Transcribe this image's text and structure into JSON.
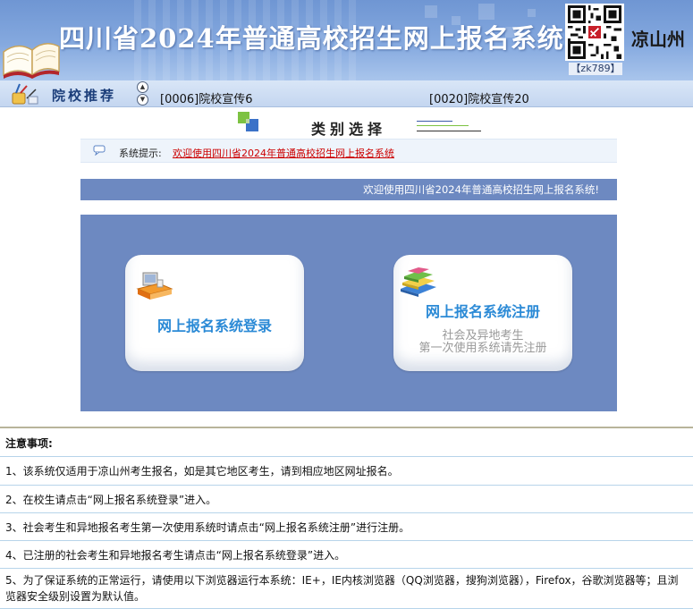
{
  "header": {
    "title": "四川省2024年普通高校招生网上报名系统",
    "region": "凉山州",
    "qr_code_label": "【zk789】"
  },
  "recommend": {
    "label": "院校推荐",
    "links": [
      "[0006]院校宣传6",
      "[0020]院校宣传20"
    ]
  },
  "category": {
    "title": "类别选择"
  },
  "tip": {
    "label": "系统提示:",
    "text": "欢迎使用四川省2024年普通高校招生网上报名系统"
  },
  "welcome": "欢迎使用四川省2024年普通高校招生网上报名系统!",
  "cards": {
    "login": {
      "title": "网上报名系统登录"
    },
    "register": {
      "title": "网上报名系统注册",
      "sub1": "社会及异地考生",
      "sub2": "第一次使用系统请先注册"
    }
  },
  "notes": {
    "heading": "注意事项:",
    "items": [
      "1、该系统仅适用于凉山州考生报名，如是其它地区考生，请到相应地区网址报名。",
      "2、在校生请点击“网上报名系统登录”进入。",
      "3、社会考生和异地报名考生第一次使用系统时请点击“网上报名系统注册”进行注册。",
      "4、已注册的社会考生和异地报名考生请点击“网上报名系统登录”进入。",
      "5、为了保证系统的正常运行，请使用以下浏览器运行本系统：IE+，IE内核浏览器（QQ浏览器，搜狗浏览器），Firefox，谷歌浏览器等；且浏览器安全级别设置为默认值。"
    ]
  },
  "colors": {
    "header_blue": "#7a9fd8",
    "panel_blue": "#6d89c1",
    "card_title": "#2b8ad6",
    "tip_red": "#cc0000"
  },
  "icons": {
    "book": "open-book-icon",
    "qr": "qr-code-icon",
    "recommend": "pencil-cup-icon",
    "category": "colored-squares-icon",
    "tip": "speech-bubble-icon",
    "login": "computer-icon",
    "register": "stacked-books-icon"
  }
}
